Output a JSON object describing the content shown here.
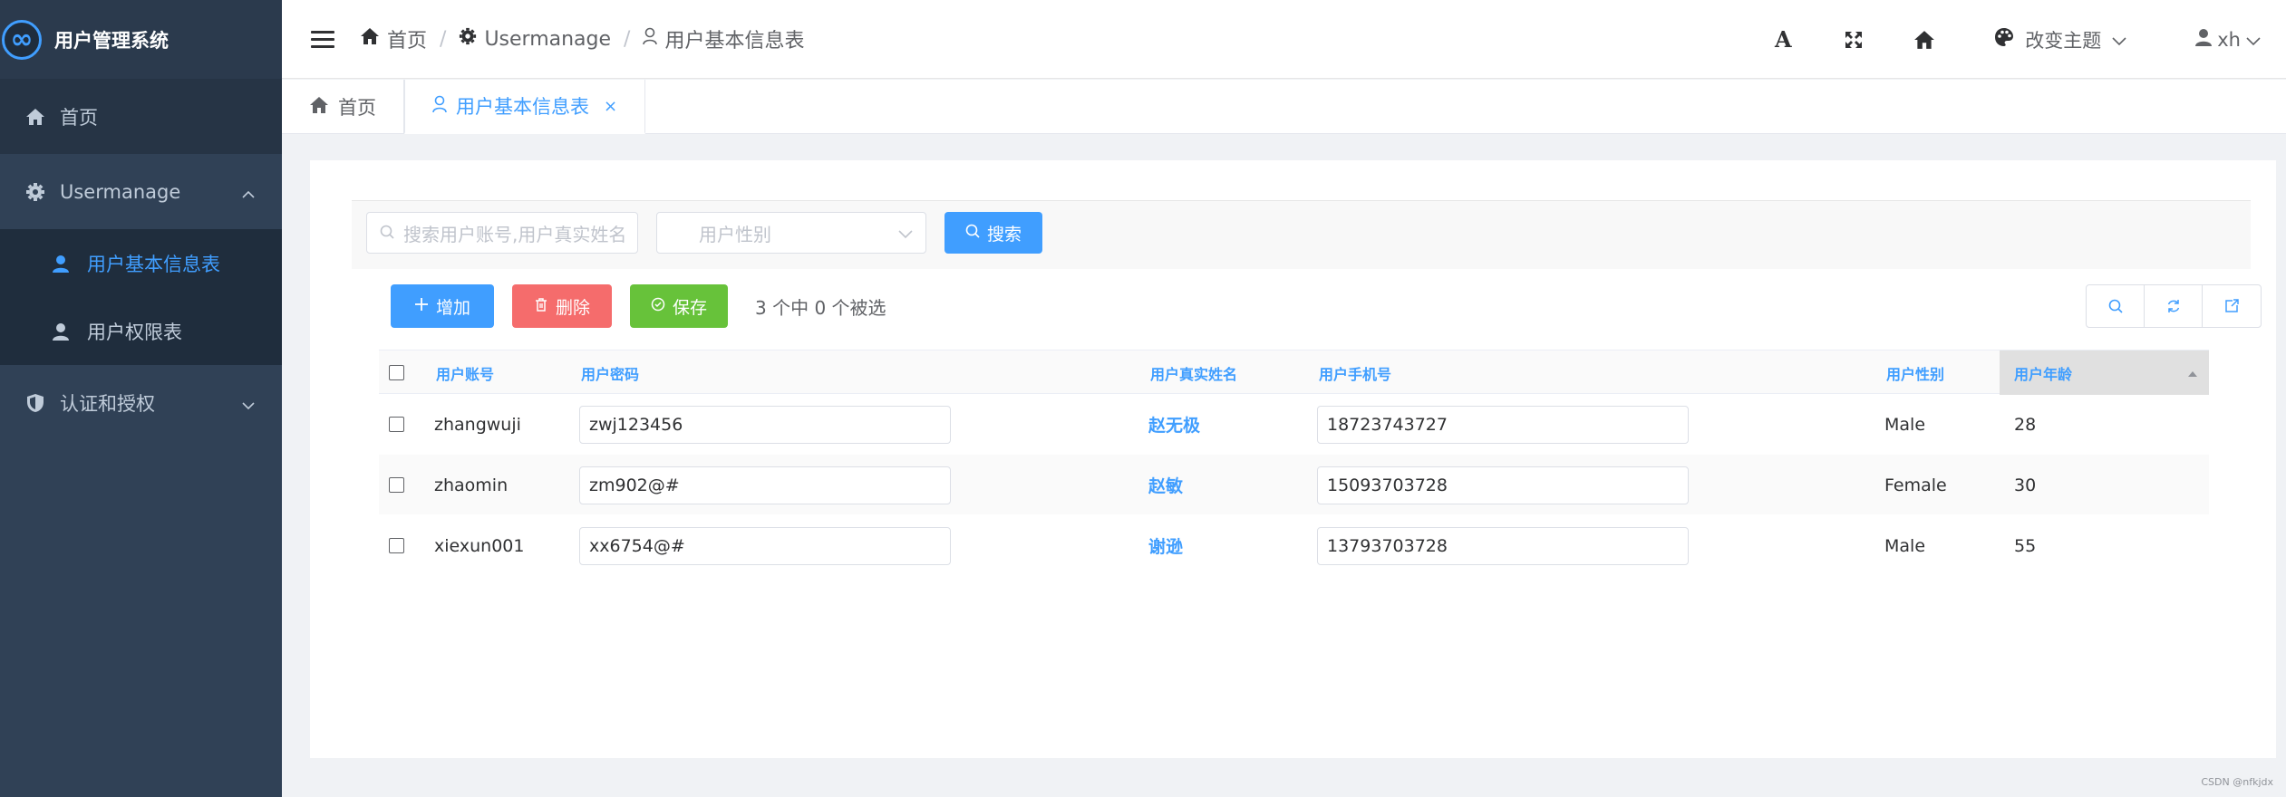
{
  "app": {
    "title": "用户管理系统"
  },
  "sidebar": {
    "items": [
      {
        "label": "首页"
      },
      {
        "label": "Usermanage",
        "children": [
          {
            "label": "用户基本信息表"
          },
          {
            "label": "用户权限表"
          }
        ]
      },
      {
        "label": "认证和授权"
      }
    ]
  },
  "header": {
    "breadcrumb": [
      "首页",
      "Usermanage",
      "用户基本信息表"
    ],
    "separator": "/",
    "font_icon": "A",
    "theme_label": "改变主题",
    "user_name": "xh"
  },
  "tabs": [
    {
      "label": "首页"
    },
    {
      "label": "用户基本信息表",
      "close": "×"
    }
  ],
  "search": {
    "input_placeholder": "搜索用户账号,用户真实姓名",
    "select_placeholder": "用户性别",
    "button_label": "搜索"
  },
  "toolbar": {
    "add_label": "增加",
    "delete_label": "删除",
    "save_label": "保存",
    "selection_info": "3 个中 0 个被选"
  },
  "table": {
    "columns": [
      "用户账号",
      "用户密码",
      "用户真实姓名",
      "用户手机号",
      "用户性别",
      "用户年龄"
    ],
    "rows": [
      {
        "account": "zhangwuji",
        "password": "zwj123456",
        "real_name": "赵无极",
        "phone": "18723743727",
        "gender": "Male",
        "age": "28"
      },
      {
        "account": "zhaomin",
        "password": "zm902@#",
        "real_name": "赵敏",
        "phone": "15093703728",
        "gender": "Female",
        "age": "30"
      },
      {
        "account": "xiexun001",
        "password": "xx6754@#",
        "real_name": "谢逊",
        "phone": "13793703728",
        "gender": "Male",
        "age": "55"
      }
    ]
  },
  "watermark": "CSDN @nfkjdx",
  "colors": {
    "sidebar_bg": "#304156",
    "accent": "#409eff",
    "danger": "#f56c6c",
    "success": "#67c23a"
  }
}
